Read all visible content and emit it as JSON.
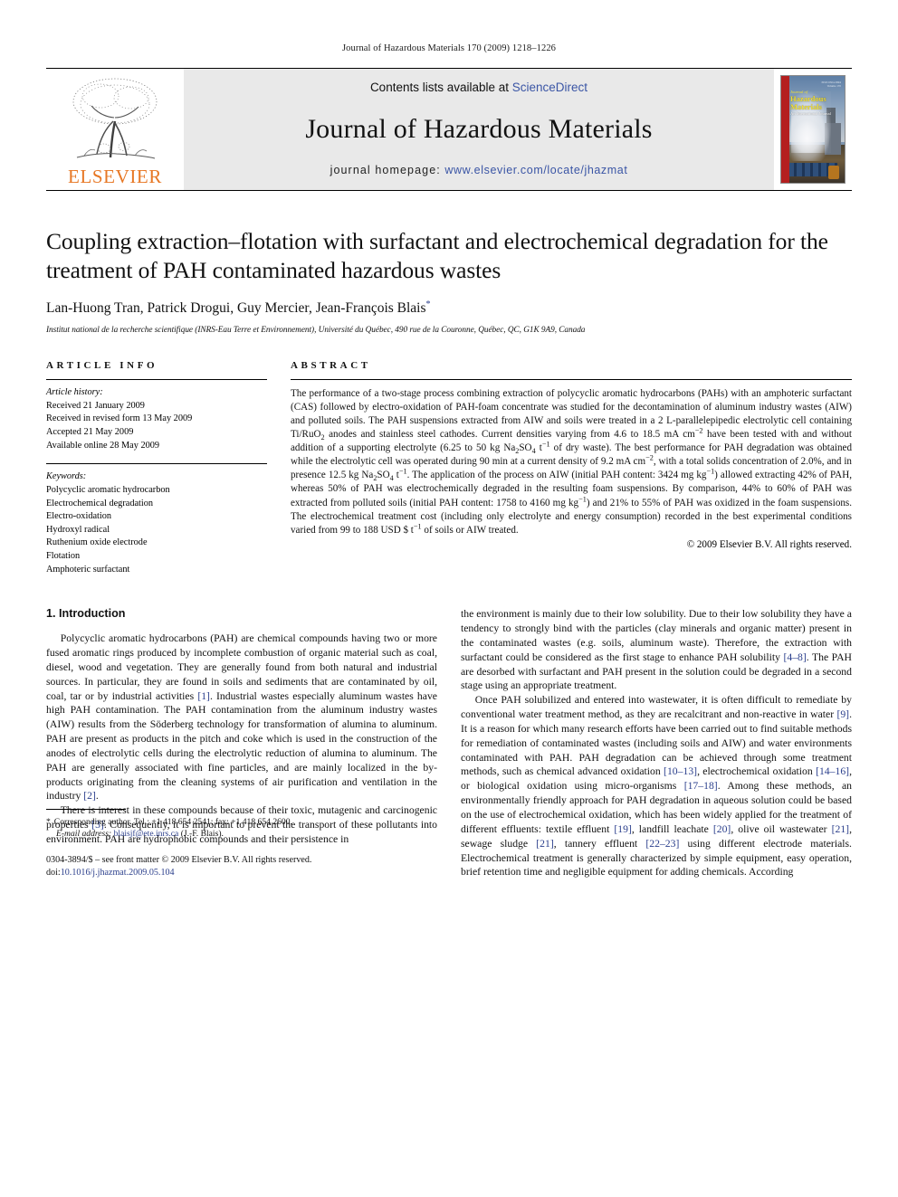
{
  "running_head": "Journal of Hazardous Materials 170 (2009) 1218–1226",
  "masthead": {
    "publisher": "ELSEVIER",
    "contents_prefix": "Contents lists available at ",
    "sciencedirect": "ScienceDirect",
    "journal_title": "Journal of Hazardous Materials",
    "homepage_prefix": "journal homepage: ",
    "homepage_url": "www.elsevier.com/locate/jhazmat",
    "link_color": "#3a55a5",
    "elsevier_orange": "#E77724",
    "cover": {
      "journal_word": "Journal of",
      "title_line1": "Hazardous",
      "title_line2": "Materials",
      "subtitle": "An International Journal",
      "spine_color": "#b41f1f"
    }
  },
  "article": {
    "title": "Coupling extraction–flotation with surfactant and electrochemical degradation for the treatment of PAH contaminated hazardous wastes",
    "authors": "Lan-Huong Tran, Patrick Drogui, Guy Mercier, Jean-François Blais",
    "corresponding_marker": "*",
    "affiliation": "Institut national de la recherche scientifique (INRS-Eau Terre et Environnement), Université du Québec, 490 rue de la Couronne, Québec, QC, G1K 9A9, Canada"
  },
  "article_info": {
    "heading": "ARTICLE INFO",
    "history_label": "Article history:",
    "history": [
      "Received 21 January 2009",
      "Received in revised form 13 May 2009",
      "Accepted 21 May 2009",
      "Available online 28 May 2009"
    ],
    "keywords_label": "Keywords:",
    "keywords": [
      "Polycyclic aromatic hydrocarbon",
      "Electrochemical degradation",
      "Electro-oxidation",
      "Hydroxyl radical",
      "Ruthenium oxide electrode",
      "Flotation",
      "Amphoteric surfactant"
    ]
  },
  "abstract": {
    "heading": "ABSTRACT",
    "copyright": "© 2009 Elsevier B.V. All rights reserved."
  },
  "introduction": {
    "heading": "1. Introduction"
  },
  "footnote": {
    "corresponding": "Corresponding author. Tel.: +1 418 654 2541; fax: +1 418 654 2600.",
    "email_label": "E-mail address:",
    "email": "blaisjf@ete.inrs.ca",
    "email_suffix": "(J.-F. Blais).",
    "issn_line": "0304-3894/$ – see front matter © 2009 Elsevier B.V. All rights reserved.",
    "doi_label": "doi:",
    "doi": "10.1016/j.jhazmat.2009.05.104"
  }
}
